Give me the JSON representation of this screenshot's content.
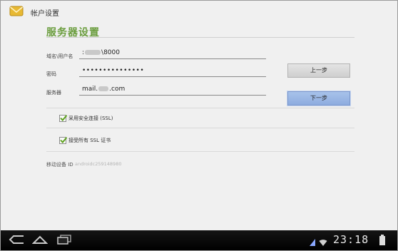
{
  "header": {
    "title": "帐户设置",
    "app_icon": "mail-envelope-icon"
  },
  "page": {
    "section_title": "服务器设置"
  },
  "form": {
    "domain_username": {
      "label": "域名\\用户名",
      "value_prefix": ":",
      "value_suffix": "\\8000"
    },
    "password": {
      "label": "密码",
      "value": "•••••••••••••••"
    },
    "server": {
      "label": "服务器",
      "value_prefix": "mail.",
      "value_suffix": ".com"
    }
  },
  "buttons": {
    "prev": "上一步",
    "next": "下一步"
  },
  "options": {
    "ssl": {
      "label": "采用安全连接 (SSL)",
      "checked": true
    },
    "accept_all": {
      "label": "接受所有 SSL 证书",
      "checked": true
    }
  },
  "device": {
    "label": "移动设备 ID",
    "value": "androidc259148980"
  },
  "statusbar": {
    "time": "23:18",
    "icons": [
      "back-icon",
      "home-icon",
      "recent-apps-icon",
      "signal-icon",
      "wifi-icon",
      "battery-icon"
    ]
  },
  "colors": {
    "accent_green": "#6a9d3d",
    "next_button": "#8eacdf",
    "navbar": "#000000"
  }
}
